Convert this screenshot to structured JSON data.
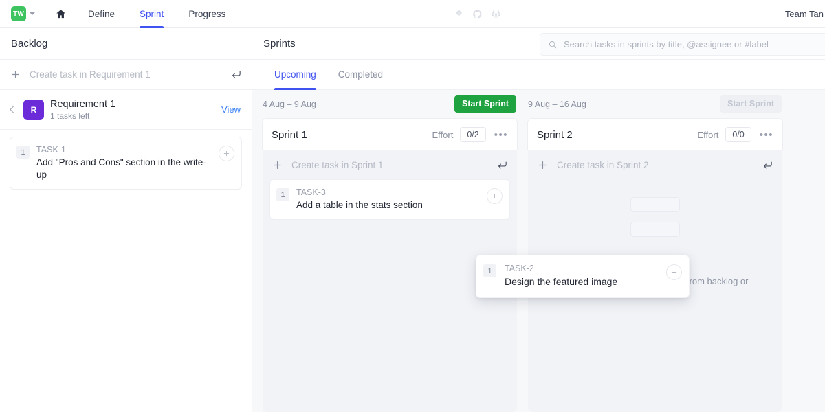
{
  "topnav": {
    "workspace_initials": "TW",
    "workspace_color": "#3dc460",
    "home_icon": "home-icon",
    "links": [
      {
        "label": "Define",
        "active": false
      },
      {
        "label": "Sprint",
        "active": true
      },
      {
        "label": "Progress",
        "active": false
      }
    ],
    "integrations": [
      "jira-icon",
      "github-icon",
      "gitlab-icon"
    ],
    "team_name": "Team Tan",
    "accent_color": "#4053f0"
  },
  "sidebar": {
    "title": "Backlog",
    "create_task": {
      "placeholder": "Create task in Requirement 1",
      "plus_icon": "plus-icon",
      "enter_icon": "enter-key-icon"
    },
    "requirement": {
      "collapse_icon": "chevron-left-icon",
      "avatar_initial": "R",
      "avatar_color": "#6b2bd9",
      "name": "Requirement 1",
      "subtitle": "1 tasks left",
      "view_label": "View"
    },
    "tasks": [
      {
        "effort": "1",
        "key": "TASK-1",
        "title": "Add \"Pros and Cons\" section in the write-up"
      }
    ]
  },
  "main": {
    "title": "Sprints",
    "search": {
      "icon": "search-icon",
      "placeholder": "Search tasks in sprints by title, @assignee or #label",
      "value": ""
    },
    "tabs": [
      {
        "label": "Upcoming",
        "active": true
      },
      {
        "label": "Completed",
        "active": false
      }
    ],
    "columns": [
      {
        "dates": "4 Aug – 9 Aug",
        "start_label": "Start Sprint",
        "start_enabled": true,
        "name": "Sprint 1",
        "effort_label": "Effort",
        "effort_value": "0/2",
        "menu_icon": "more-options-icon",
        "create_placeholder": "Create task in Sprint 1",
        "tasks": [
          {
            "effort": "1",
            "key": "TASK-3",
            "title": "Add a table in the stats section"
          }
        ],
        "empty_text": ""
      },
      {
        "dates": "9 Aug – 16 Aug",
        "start_label": "Start Sprint",
        "start_enabled": false,
        "name": "Sprint 2",
        "effort_label": "Effort",
        "effort_value": "0/0",
        "menu_icon": "more-options-icon",
        "create_placeholder": "Create task in Sprint 2",
        "tasks": [],
        "empty_text": "Plan a sprint by dragging tasks from backlog or create a task."
      }
    ]
  },
  "drag_card": {
    "effort": "1",
    "key": "TASK-2",
    "title": "Design the featured image"
  }
}
